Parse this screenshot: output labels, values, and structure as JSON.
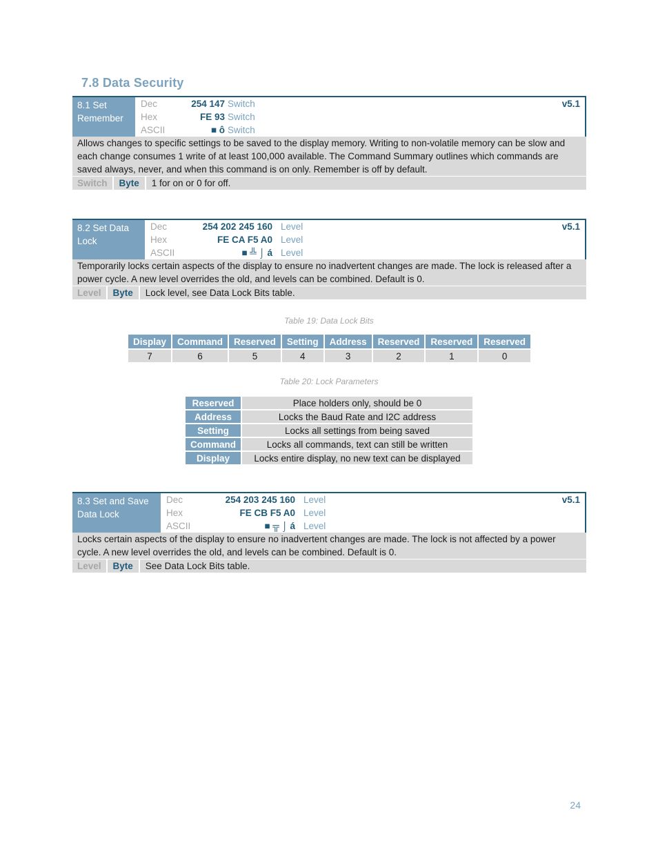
{
  "section_title": "7.8 Data Security",
  "code_labels": {
    "dec": "Dec",
    "hex": "Hex",
    "ascii": "ASCII"
  },
  "commands": [
    {
      "name": "8.1 Set Remember",
      "name_line1": "8.1 Set",
      "name_line2": "Remember",
      "dec": "254 147",
      "hex": "FE 93",
      "ascii": "■ ô",
      "param_label": "Switch",
      "version": "v5.1",
      "description": "Allows changes to specific settings to be saved to the display memory.  Writing to non-volatile memory can be slow and each change consumes 1 write of at least 100,000 available.  The Command Summary outlines which commands are saved always, never, and when this command is on only.  Remember is off by default.",
      "parameter": {
        "name": "Switch",
        "type": "Byte",
        "description": "1 for on or 0 for off."
      }
    },
    {
      "name": "8.2 Set Data Lock",
      "name_line1": "8.2 Set Data",
      "name_line2": "Lock",
      "dec": "254 202 245 160",
      "hex": "FE CA F5 A0",
      "ascii": "■ ╩ ⌡ á",
      "param_label": "Level",
      "version": "v5.1",
      "description": "Temporarily locks certain aspects of the display to ensure no inadvertent changes are made.  The lock is released after a power cycle.  A new level overrides the old, and levels can be combined.  Default is 0.",
      "parameter": {
        "name": "Level",
        "type": "Byte",
        "description": "Lock level, see Data Lock Bits table."
      }
    },
    {
      "name": "8.3 Set and Save Data Lock",
      "name_line1": "8.3 Set and Save",
      "name_line2": "Data Lock",
      "dec": "254 203 245 160",
      "hex": "FE CB F5 A0",
      "ascii": "■ ╦ ⌡ á",
      "param_label": "Level",
      "version": "v5.1",
      "description": "Locks certain aspects of the display to ensure no inadvertent changes are made.  The lock is not affected by a power cycle.  A new level overrides the old, and levels can be combined.  Default is 0.",
      "parameter": {
        "name": "Level",
        "type": "Byte",
        "description": "See Data Lock Bits table."
      }
    }
  ],
  "table19": {
    "caption": "Table 19: Data Lock Bits",
    "headers": [
      "Display",
      "Command",
      "Reserved",
      "Setting",
      "Address",
      "Reserved",
      "Reserved",
      "Reserved"
    ],
    "values": [
      "7",
      "6",
      "5",
      "4",
      "3",
      "2",
      "1",
      "0"
    ]
  },
  "table20": {
    "caption": "Table 20: Lock Parameters",
    "rows": [
      {
        "name": "Reserved",
        "description": "Place holders only, should be 0"
      },
      {
        "name": "Address",
        "description": "Locks the Baud Rate and I2C address"
      },
      {
        "name": "Setting",
        "description": "Locks all settings from being saved"
      },
      {
        "name": "Command",
        "description": "Locks all commands, text can still be written"
      },
      {
        "name": "Display",
        "description": "Locks entire display, no new text can be displayed"
      }
    ]
  },
  "page_number": "24"
}
